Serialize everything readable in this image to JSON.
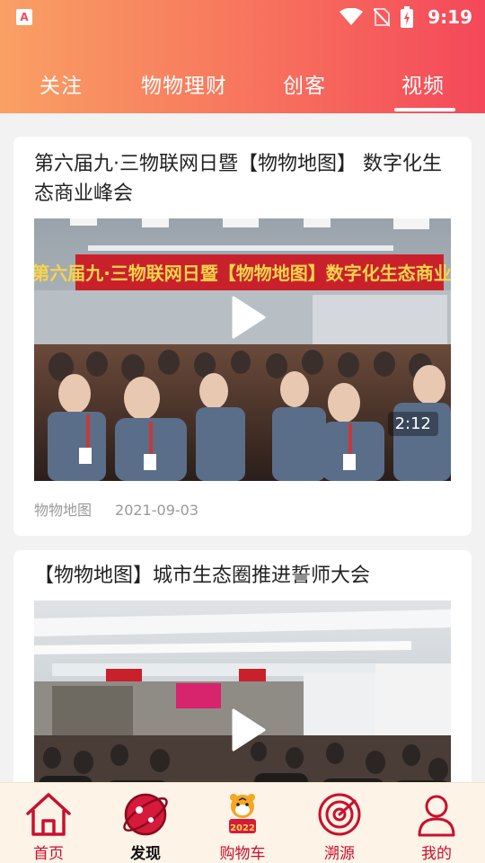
{
  "status_bar": {
    "app_badge": "A",
    "time": "9:19"
  },
  "tabs": [
    {
      "label": "关注"
    },
    {
      "label": "物物理财"
    },
    {
      "label": "创客"
    },
    {
      "label": "视频",
      "active": true
    }
  ],
  "feed": [
    {
      "title": "第六届九·三物联网日暨【物物地图】 数字化生态商业峰会",
      "banner_text": "第六届九·三物联网日暨【物物地图】数字化生态商业峰会",
      "duration": "2:12",
      "source": "物物地图",
      "date": "2021-09-03"
    },
    {
      "title": "【物物地图】城市生态圈推进誓师大会"
    }
  ],
  "bottom_nav": [
    {
      "label": "首页",
      "icon": "home-icon"
    },
    {
      "label": "发现",
      "icon": "planet-icon",
      "active": true
    },
    {
      "label": "购物车",
      "icon": "tiger-mascot-icon"
    },
    {
      "label": "溯源",
      "icon": "radar-icon"
    },
    {
      "label": "我的",
      "icon": "person-icon"
    }
  ],
  "colors": {
    "accent": "#c8102e",
    "header_start": "#f9a064",
    "header_end": "#f4485a",
    "nav_bg": "#fdf3e7"
  }
}
